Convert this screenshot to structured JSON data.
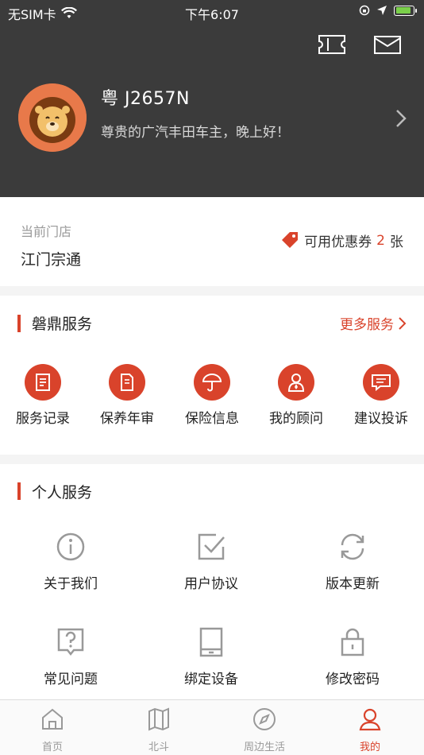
{
  "status_bar": {
    "carrier": "无SIM卡",
    "time": "下午6:07"
  },
  "header": {
    "plate": "粤 J2657N",
    "greeting": "尊贵的广汽丰田车主，晚上好！"
  },
  "store": {
    "label": "当前门店",
    "name": "江门宗通",
    "coupon_prefix": "可用优惠券",
    "coupon_count": "2",
    "coupon_suffix": "张"
  },
  "services": {
    "title": "磐鼎服务",
    "more": "更多服务",
    "items": [
      {
        "label": "服务记录",
        "icon": "document-icon"
      },
      {
        "label": "保养年审",
        "icon": "file-edit-icon"
      },
      {
        "label": "保险信息",
        "icon": "umbrella-icon"
      },
      {
        "label": "我的顾问",
        "icon": "advisor-icon"
      },
      {
        "label": "建议投诉",
        "icon": "message-icon"
      }
    ]
  },
  "personal": {
    "title": "个人服务",
    "items": [
      {
        "label": "关于我们",
        "icon": "info-icon"
      },
      {
        "label": "用户协议",
        "icon": "checkbox-icon"
      },
      {
        "label": "版本更新",
        "icon": "refresh-icon"
      },
      {
        "label": "常见问题",
        "icon": "question-icon"
      },
      {
        "label": "绑定设备",
        "icon": "tablet-icon"
      },
      {
        "label": "修改密码",
        "icon": "lock-icon"
      }
    ]
  },
  "tabbar": {
    "items": [
      {
        "label": "首页",
        "icon": "home-icon",
        "active": false
      },
      {
        "label": "北斗",
        "icon": "map-icon",
        "active": false
      },
      {
        "label": "周边生活",
        "icon": "compass-icon",
        "active": false
      },
      {
        "label": "我的",
        "icon": "user-icon",
        "active": true
      }
    ]
  },
  "colors": {
    "accent": "#d9432b",
    "header_bg": "#3b3b3b"
  }
}
